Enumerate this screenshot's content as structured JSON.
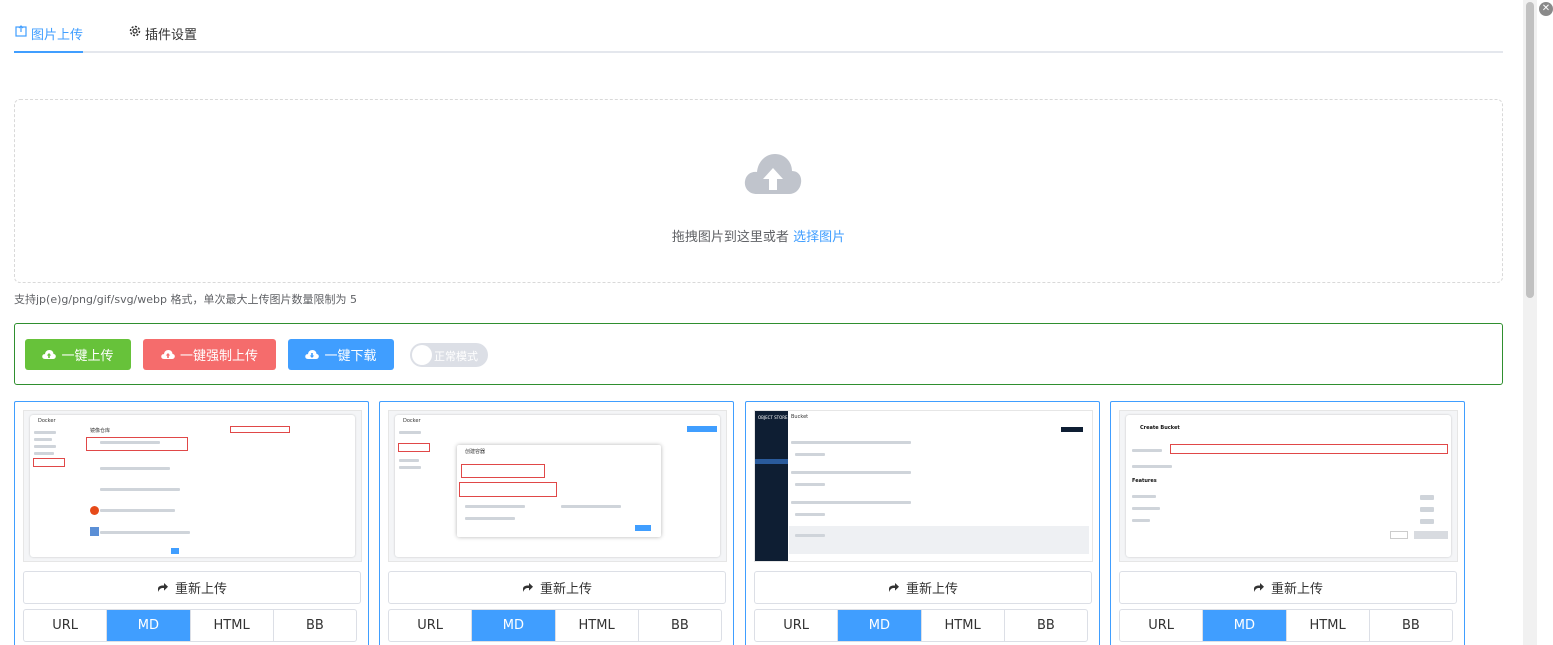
{
  "tabs": [
    {
      "label": "图片上传",
      "icon": "upload-image-icon",
      "active": true
    },
    {
      "label": "插件设置",
      "icon": "gear-icon",
      "active": false
    }
  ],
  "upload": {
    "prompt": "拖拽图片到这里或者",
    "link": "选择图片",
    "tip": "支持jp(e)g/png/gif/svg/webp 格式，单次最大上传图片数量限制为 5"
  },
  "toolbar": {
    "upload_all": "一键上传",
    "force_upload": "一键强制上传",
    "download_all": "一键下载",
    "mode_switch": "正常模式"
  },
  "cards": [
    {
      "reupload": "重新上传",
      "formats": [
        "URL",
        "MD",
        "HTML",
        "BB"
      ],
      "selected": "MD"
    },
    {
      "reupload": "重新上传",
      "formats": [
        "URL",
        "MD",
        "HTML",
        "BB"
      ],
      "selected": "MD"
    },
    {
      "reupload": "重新上传",
      "formats": [
        "URL",
        "MD",
        "HTML",
        "BB"
      ],
      "selected": "MD"
    },
    {
      "reupload": "重新上传",
      "formats": [
        "URL",
        "MD",
        "HTML",
        "BB"
      ],
      "selected": "MD"
    }
  ],
  "thumbnails": {
    "docker_title": "Docker",
    "docker_heading": "镜像仓库",
    "dialog_title": "创建容器",
    "bucket_title": "Bucket",
    "create_bucket": "Create Bucket",
    "features": "Features",
    "object_store": "OBJECT STORE"
  },
  "colors": {
    "primary": "#409eff",
    "success": "#67c23a",
    "danger": "#f56c6c",
    "toolbar_border": "#2f8f2f"
  }
}
